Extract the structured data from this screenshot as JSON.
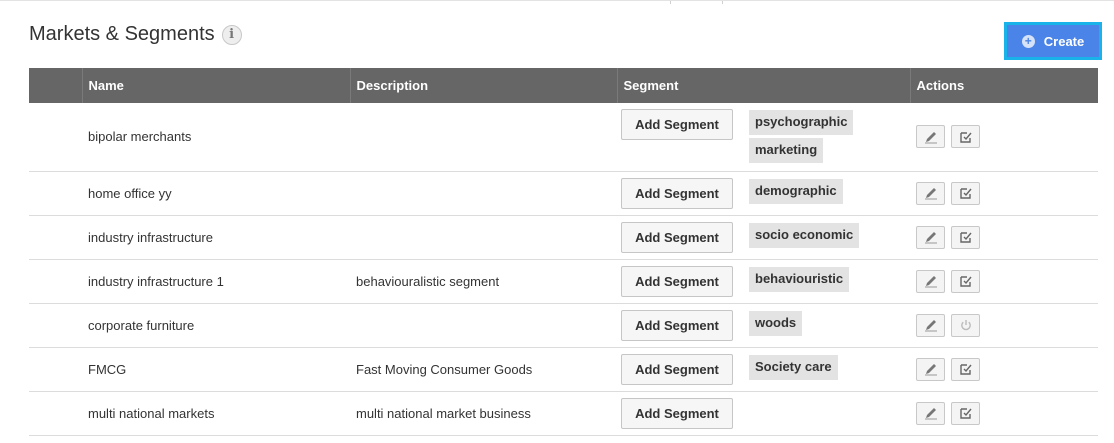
{
  "header": {
    "title": "Markets & Segments",
    "info_icon": "info-icon",
    "create_label": "Create"
  },
  "table": {
    "columns": [
      "",
      "Name",
      "Description",
      "Segment",
      "Actions"
    ],
    "add_segment_label": "Add Segment",
    "rows": [
      {
        "name": "bipolar merchants",
        "description": "",
        "segments": [
          "psychographic",
          "marketing"
        ],
        "actions": [
          "edit-icon",
          "checkbox-edit-icon"
        ]
      },
      {
        "name": "home office yy",
        "description": "",
        "segments": [
          "demographic"
        ],
        "actions": [
          "edit-icon",
          "checkbox-edit-icon"
        ]
      },
      {
        "name": "industry infrastructure",
        "description": "",
        "segments": [
          "socio economic"
        ],
        "actions": [
          "edit-icon",
          "checkbox-edit-icon"
        ]
      },
      {
        "name": "industry infrastructure 1",
        "description": "behaviouralistic segment",
        "segments": [
          "behaviouristic"
        ],
        "actions": [
          "edit-icon",
          "checkbox-edit-icon"
        ]
      },
      {
        "name": "corporate furniture",
        "description": "",
        "segments": [
          "woods"
        ],
        "actions": [
          "edit-icon",
          "power-icon"
        ]
      },
      {
        "name": "FMCG",
        "description": "Fast Moving Consumer Goods",
        "segments": [
          "Society care"
        ],
        "actions": [
          "edit-icon",
          "checkbox-edit-icon"
        ]
      },
      {
        "name": "multi national markets",
        "description": "multi national market business",
        "segments": [],
        "actions": [
          "edit-icon",
          "checkbox-edit-icon"
        ]
      }
    ]
  },
  "colors": {
    "header_bg": "#666666",
    "create_bg": "#4a84e8",
    "create_outline": "#19b3ea",
    "tag_bg": "#e3e3e3"
  }
}
